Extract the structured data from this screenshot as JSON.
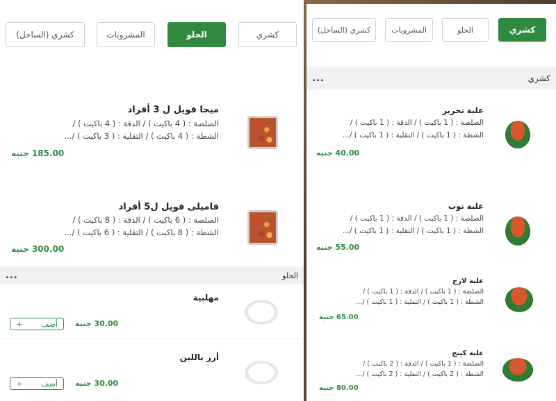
{
  "left": {
    "tabs": [
      {
        "label": "كشري",
        "active": false
      },
      {
        "label": "الحلو",
        "active": true
      },
      {
        "label": "المشروبات",
        "active": false
      },
      {
        "label": "كشري (الساحل)",
        "active": false
      }
    ],
    "items": [
      {
        "name": "ميجا فويل ل 3 أفراد",
        "desc1": "الصلصة : ( 4 باكيت ) / الدقة : ( 4 باكيت ) /",
        "desc2": "الشطة : ( 4 باكيت ) / التقلية : ( 3 باكيت ) /...",
        "price": "185.00 جنيه",
        "image": "koshari-tray"
      },
      {
        "name": "فاميلى فويل ل5 أفراد",
        "desc1": "الصلصة : ( 6 باكيت ) / الدقة : ( 8 باكيت ) /",
        "desc2": "الشطة : ( 8 باكيت ) / التقلية : ( 6 باكيت ) /...",
        "price": "300.00 جنيه",
        "image": "koshari-tray"
      }
    ],
    "section": {
      "title": "الحلو",
      "more": "..."
    },
    "sweets": [
      {
        "name": "مهلبية",
        "price": "30.00 جنيه",
        "add_label": "أضف",
        "add_icon": "+"
      },
      {
        "name": "أرز باللبن",
        "price": "30.00 جنيه",
        "add_label": "أضف",
        "add_icon": "+"
      }
    ]
  },
  "right": {
    "tabs": [
      {
        "label": "كشري",
        "active": true
      },
      {
        "label": "الحلو",
        "active": false
      },
      {
        "label": "المشروبات",
        "active": false
      },
      {
        "label": "كشري (الساحل)",
        "active": false
      }
    ],
    "section": {
      "title": "كشري",
      "more": "..."
    },
    "items": [
      {
        "name": "علبة تحرير",
        "desc1": "الصلصة : ( 1 باكيت ) / الدقة : ( 1 باكيت ) /",
        "desc2": "الشطة : ( 1 باكيت ) / التقلية : ( 1 باكيت ) /...",
        "price": "40.00 جنيه",
        "image": "koshari-bowl"
      },
      {
        "name": "علبة توب",
        "desc1": "الصلصة : ( 1 باكيت ) / الدقة : ( 1 باكيت ) /",
        "desc2": "الشطة : ( 1 باكيت ) / التقلية : ( 1 باكيت ) /...",
        "price": "55.00 جنيه",
        "image": "koshari-bowl"
      },
      {
        "name": "علبة لارج",
        "desc1": "الصلصة : ( 1 باكيت ) / الدقة : ( 1 باكيت ) /",
        "desc2": "الشطة : ( 1 باكيت ) / التقلية : ( 1 باكيت ) /...",
        "price": "65.00 جنيه",
        "image": "koshari-bowl"
      },
      {
        "name": "علبة كينج",
        "desc1": "الصلصة : ( 1 باكيت ) / الدقة : ( 2 باكيت ) /",
        "desc2": "الشطة : ( 2 باكيت ) / التقلية : ( 2 باكيت ) /...",
        "price": "80.00 جنيه",
        "image": "koshari-bowl"
      }
    ]
  },
  "colors": {
    "accent": "#2f8a3f",
    "section_bg": "#f1f1f1"
  }
}
